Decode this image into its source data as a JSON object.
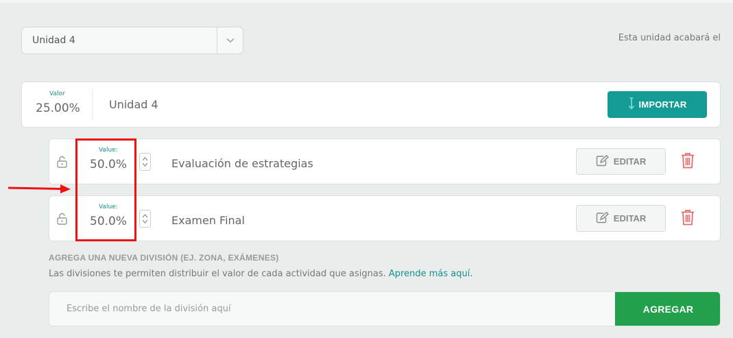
{
  "unit_select": {
    "value": "Unidad 4"
  },
  "end_notice": "Esta unidad acabará el",
  "unit_card": {
    "value_label": "Valor",
    "value": "25.00%",
    "name": "Unidad 4",
    "import_label": "IMPORTAR"
  },
  "divisions": [
    {
      "value_label": "Value:",
      "value": "50.0%",
      "name": "Evaluación de estrategias",
      "edit_label": "EDITAR"
    },
    {
      "value_label": "Value:",
      "value": "50.0%",
      "name": "Examen Final",
      "edit_label": "EDITAR"
    }
  ],
  "new_division": {
    "heading": "AGREGA UNA NUEVA DIVISIÓN (EJ. ZONA, EXÁMENES)",
    "description": "Las divisiones te permiten distribuir el valor de cada actividad que asignas.",
    "learn_more": "Aprende más aquí.",
    "input_placeholder": "Escribe el nombre de la división aquí",
    "input_value": "",
    "add_label": "AGREGAR"
  },
  "colors": {
    "teal": "#159b95",
    "green": "#22a04b",
    "annotation_red": "#ee1111",
    "trash_red": "#e56b6b"
  },
  "icons": [
    "chevron-down-icon",
    "import-arrow-icon",
    "lock-icon",
    "stepper-icon",
    "edit-icon",
    "trash-icon",
    "arrow-right-icon"
  ]
}
